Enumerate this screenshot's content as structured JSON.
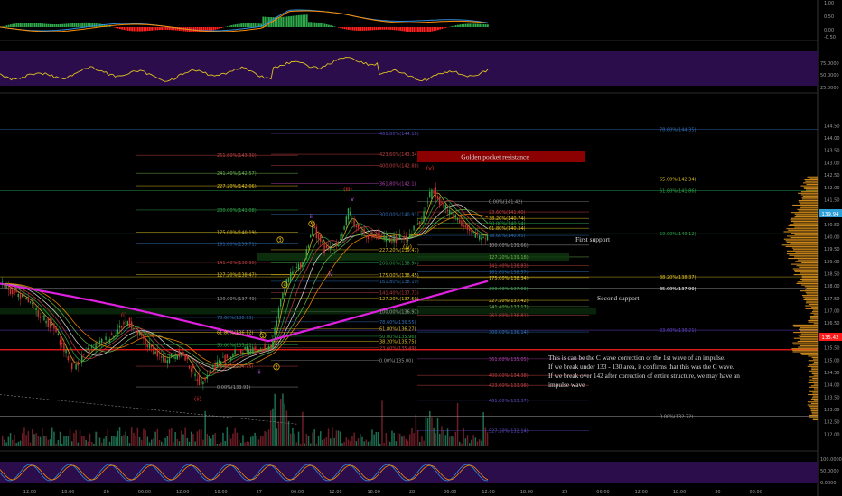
{
  "chart_data": {
    "type": "line",
    "title": "",
    "xlabel": "",
    "ylabel": "",
    "ylim": [
      131.5,
      145.5
    ],
    "x_ticks": [
      "12:00",
      "18:00",
      "26",
      "06:00",
      "12:00",
      "18:00",
      "27",
      "06:00",
      "12:00",
      "18:00",
      "28",
      "06:00",
      "12:00",
      "18:00",
      "29",
      "06:00",
      "12:00",
      "18:00",
      "30",
      "06:00"
    ],
    "y_ticks": [
      "132.00",
      "132.50",
      "133.00",
      "133.50",
      "134.00",
      "134.50",
      "135.00",
      "135.50",
      "136.00",
      "136.50",
      "137.00",
      "137.50",
      "138.00",
      "138.50",
      "139.00",
      "139.50",
      "140.00",
      "140.50",
      "141.00",
      "141.50",
      "142.00",
      "142.50",
      "143.00",
      "143.50",
      "144.00",
      "144.50"
    ],
    "price_label": "139.94",
    "price_label_2": "135.42",
    "upper_panel_ticks": [
      "1.00",
      "0.50",
      "0.00",
      "-0.50"
    ],
    "rsi_panel_ticks": [
      "75.0000",
      "50.0000",
      "25.0000"
    ],
    "bottom_panel_ticks": [
      "100.0000",
      "50.0000",
      "0.0000"
    ],
    "right_levels": [
      {
        "text": "78.60%(144.35)",
        "y": 144.35,
        "color": "#2f6fb5",
        "x": 730
      },
      {
        "text": "65.00%(142.34)",
        "y": 142.34,
        "color": "#e0c020",
        "x": 730
      },
      {
        "text": "61.80%(141.86)",
        "y": 141.86,
        "color": "#2ea84a",
        "x": 730
      },
      {
        "text": "50.00%(140.12)",
        "y": 140.12,
        "color": "#2ea84a",
        "x": 730
      },
      {
        "text": "38.20%(138.37)",
        "y": 138.37,
        "color": "#e0c020",
        "x": 730
      },
      {
        "text": "35.00%(137.90)",
        "y": 137.9,
        "color": "#ffffff",
        "x": 730
      },
      {
        "text": "23.60%(136.21)",
        "y": 136.21,
        "color": "#6040c0",
        "x": 730
      },
      {
        "text": "0.00%(132.72)",
        "y": 132.72,
        "color": "#9a9a9a",
        "x": 730
      }
    ],
    "fib_labels": [
      {
        "text": "461.80%(144.18)",
        "y": 144.18,
        "x": 420,
        "color": "#5a4cc0"
      },
      {
        "text": "261.80%(143.30)",
        "y": 143.3,
        "x": 240,
        "color": "#c04040"
      },
      {
        "text": "423.60%(143.34)",
        "y": 143.34,
        "x": 420,
        "color": "#c04040"
      },
      {
        "text": "400.00%(142.88)",
        "y": 142.88,
        "x": 420,
        "color": "#c04040"
      },
      {
        "text": "241.40%(142.57)",
        "y": 142.57,
        "x": 240,
        "color": "#6ab04c"
      },
      {
        "text": "361.80%(142.1)",
        "y": 142.15,
        "x": 420,
        "color": "#b040b0"
      },
      {
        "text": "227.20%(142.06)",
        "y": 142.06,
        "x": 240,
        "color": "#e0c020"
      },
      {
        "text": "0.00%(141.42)",
        "y": 141.42,
        "x": 541,
        "color": "#9a9a9a"
      },
      {
        "text": "200.00%(141.08)",
        "y": 141.08,
        "x": 240,
        "color": "#2ea84a"
      },
      {
        "text": "300.00%(140.91)",
        "y": 140.91,
        "x": 420,
        "color": "#2f6fb5"
      },
      {
        "text": "23.60%(141.00)",
        "y": 141.0,
        "x": 541,
        "color": "#c04040"
      },
      {
        "text": "38.20%(140.74)",
        "y": 140.74,
        "x": 541,
        "color": "#e0c020"
      },
      {
        "text": "50.00%(140.54)",
        "y": 140.54,
        "x": 541,
        "color": "#2ea84a"
      },
      {
        "text": "61.80%(140.34)",
        "y": 140.34,
        "x": 541,
        "color": "#e0c020"
      },
      {
        "text": "175.00%(140.19)",
        "y": 140.19,
        "x": 240,
        "color": "#e0c020"
      },
      {
        "text": "78.60%(140.05)",
        "y": 140.05,
        "x": 541,
        "color": "#2f6fb5"
      },
      {
        "text": "161.80%(139.71)",
        "y": 139.71,
        "x": 240,
        "color": "#2f6fb5"
      },
      {
        "text": "100.00%(139.66)",
        "y": 139.66,
        "x": 541,
        "color": "#9a9a9a"
      },
      {
        "text": "227.20%(139.47)",
        "y": 139.47,
        "x": 420,
        "color": "#e0c020"
      },
      {
        "text": "127.20%(139.18)",
        "y": 139.18,
        "x": 541,
        "color": "#6ab04c"
      },
      {
        "text": "141.40%(138.96)",
        "y": 138.96,
        "x": 240,
        "color": "#c04040"
      },
      {
        "text": "200.00%(138.94)",
        "y": 138.94,
        "x": 420,
        "color": "#2ea84a"
      },
      {
        "text": "141.40%(138.83)",
        "y": 138.83,
        "x": 541,
        "color": "#c04040"
      },
      {
        "text": "161.80%(138.57)",
        "y": 138.57,
        "x": 541,
        "color": "#2f6fb5"
      },
      {
        "text": "127.20%(138.47)",
        "y": 138.47,
        "x": 240,
        "color": "#e0c020"
      },
      {
        "text": "175.00%(138.45)",
        "y": 138.45,
        "x": 420,
        "color": "#e0c020"
      },
      {
        "text": "175.00%(138.34)",
        "y": 138.34,
        "x": 541,
        "color": "#e0c020"
      },
      {
        "text": "161.80%(138.19)",
        "y": 138.19,
        "x": 420,
        "color": "#2f6fb5"
      },
      {
        "text": "200.00%(137.90)",
        "y": 137.9,
        "x": 541,
        "color": "#2ea84a"
      },
      {
        "text": "141.40%(137.73)",
        "y": 137.73,
        "x": 420,
        "color": "#c04040"
      },
      {
        "text": "127.20%(137.50)",
        "y": 137.5,
        "x": 420,
        "color": "#e0c020"
      },
      {
        "text": "100.00%(137.49)",
        "y": 137.49,
        "x": 240,
        "color": "#9a9a9a"
      },
      {
        "text": "227.20%(137.42)",
        "y": 137.42,
        "x": 541,
        "color": "#e0c020"
      },
      {
        "text": "241.40%(137.17)",
        "y": 137.17,
        "x": 541,
        "color": "#6ab04c"
      },
      {
        "text": "100.00%(136.97)",
        "y": 136.97,
        "x": 420,
        "color": "#9a9a9a"
      },
      {
        "text": "261.80%(136.81)",
        "y": 136.81,
        "x": 541,
        "color": "#c04040"
      },
      {
        "text": "78.60%(136.73)",
        "y": 136.73,
        "x": 240,
        "color": "#2f6fb5"
      },
      {
        "text": "78.60%(136.55)",
        "y": 136.55,
        "x": 420,
        "color": "#2f6fb5"
      },
      {
        "text": "61.80%(136.27)",
        "y": 136.27,
        "x": 420,
        "color": "#e0c020"
      },
      {
        "text": "61.80%(136.12)",
        "y": 136.12,
        "x": 240,
        "color": "#e0c020"
      },
      {
        "text": "300.00%(136.14)",
        "y": 136.14,
        "x": 541,
        "color": "#2f6fb5"
      },
      {
        "text": "50.00%(135.96)",
        "y": 135.96,
        "x": 420,
        "color": "#2ea84a"
      },
      {
        "text": "38.20%(135.75)",
        "y": 135.75,
        "x": 420,
        "color": "#e0c020"
      },
      {
        "text": "23.60%(135.49)",
        "y": 135.49,
        "x": 420,
        "color": "#c04040"
      },
      {
        "text": "50.00%(135.62)",
        "y": 135.62,
        "x": 240,
        "color": "#2ea84a"
      },
      {
        "text": "0.00%(135.00)",
        "y": 135.0,
        "x": 420,
        "color": "#9a9a9a"
      },
      {
        "text": "361.80%(135.05)",
        "y": 135.05,
        "x": 541,
        "color": "#b040b0"
      },
      {
        "text": "23.60%(134.75)",
        "y": 134.75,
        "x": 240,
        "color": "#c04040"
      },
      {
        "text": "400.00%(134.38)",
        "y": 134.38,
        "x": 541,
        "color": "#c04040"
      },
      {
        "text": "423.60%(133.98)",
        "y": 133.98,
        "x": 541,
        "color": "#c04040"
      },
      {
        "text": "0.00%(133.91)",
        "y": 133.91,
        "x": 240,
        "color": "#9a9a9a"
      },
      {
        "text": "461.80%(133.37)",
        "y": 133.37,
        "x": 541,
        "color": "#5a4cc0"
      },
      {
        "text": "527.20%(132.14)",
        "y": 132.14,
        "x": 541,
        "color": "#5a4cc0"
      }
    ],
    "wave_labels": [
      {
        "text": "(i)",
        "x": 137,
        "y": 136.75,
        "color": "#ff3030"
      },
      {
        "text": "(ii)",
        "x": 219,
        "y": 133.35,
        "color": "#ff3030"
      },
      {
        "text": "(iii)",
        "x": 385,
        "y": 141.85,
        "color": "#ff3030"
      },
      {
        "text": "(iv)",
        "x": 451,
        "y": 139.5,
        "color": "#ffd000"
      },
      {
        "text": "(v)",
        "x": 476,
        "y": 142.7,
        "color": "#ff3030"
      },
      {
        "text": "i",
        "x": 289,
        "y": 136.05,
        "color": "#e0e0e0"
      },
      {
        "text": "ii",
        "x": 287,
        "y": 134.45,
        "color": "#cc66ff"
      },
      {
        "text": "iii",
        "x": 345,
        "y": 140.75,
        "color": "#cc66ff"
      },
      {
        "text": "iv",
        "x": 366,
        "y": 138.4,
        "color": "#cc66ff"
      },
      {
        "text": "v",
        "x": 390,
        "y": 141.45,
        "color": "#cc66ff"
      }
    ],
    "circle_labels": [
      {
        "text": "1",
        "x": 291,
        "y": 135.93
      },
      {
        "text": "2",
        "x": 306,
        "y": 134.65
      },
      {
        "text": "3",
        "x": 310,
        "y": 139.8
      },
      {
        "text": "4",
        "x": 315,
        "y": 137.98
      },
      {
        "text": "5",
        "x": 345,
        "y": 140.45
      }
    ],
    "annotations": {
      "golden_pocket": "Golden pocket resistance",
      "first_support": "First support",
      "second_support": "Second support",
      "note_lines": [
        "This is can be the C wave correction or the 1st wave of an impulse.",
        "If we break under 133 - 130  area, it confirms that this was the C wave.",
        "If we break over 142 after correction of entire structure, we may have an",
        "impulse wave"
      ]
    },
    "colors": {
      "background": "#000000",
      "ema_magenta": "#e020e0",
      "support_line": "#ff1a1a",
      "golden_box": "#8b0000",
      "volume_profile": "#f0a020"
    }
  }
}
